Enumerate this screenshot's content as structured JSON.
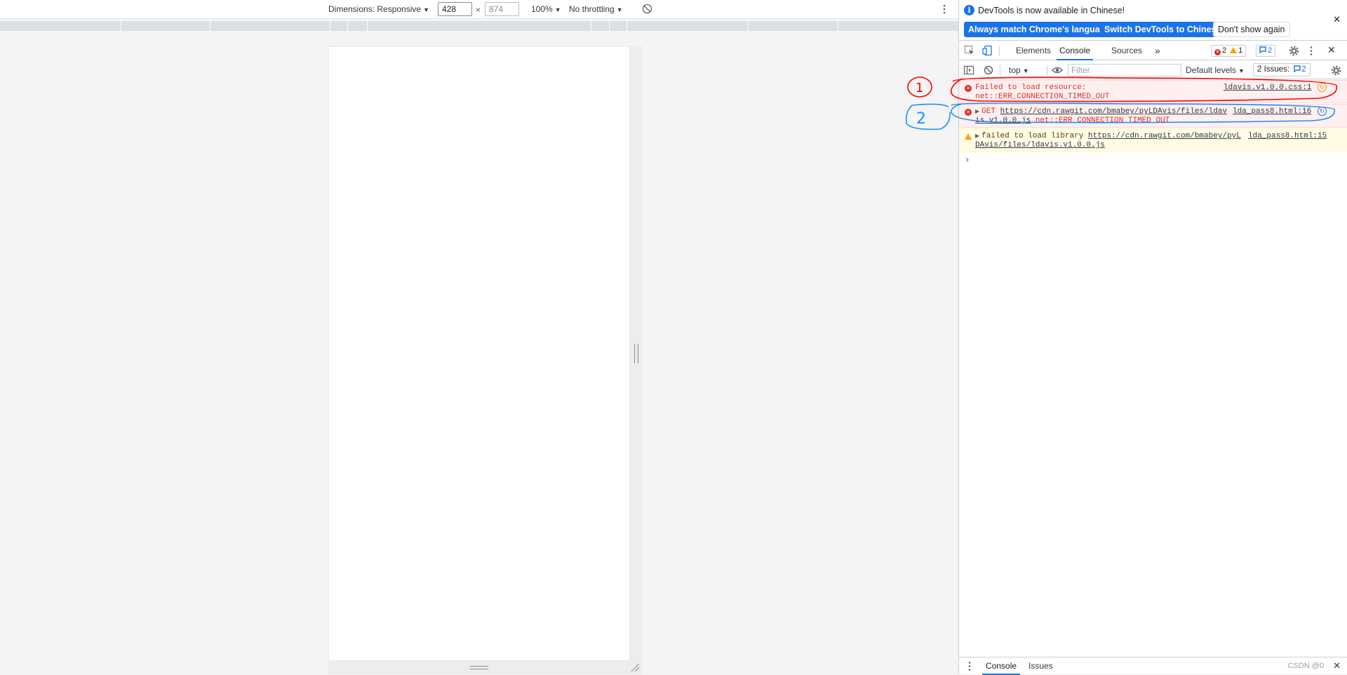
{
  "device_toolbar": {
    "dimensions_label": "Dimensions: Responsive",
    "width": "428",
    "times": "×",
    "height": "874",
    "zoom": "100%",
    "throttling": "No throttling"
  },
  "infobar": {
    "message": "DevTools is now available in Chinese!",
    "btn_match": "Always match Chrome's language",
    "btn_switch": "Switch DevTools to Chinese",
    "btn_dismiss": "Don't show again"
  },
  "tabs": {
    "elements": "Elements",
    "console": "Console",
    "sources": "Sources",
    "more": "»",
    "error_count": "2",
    "warning_count": "1",
    "message_count": "2"
  },
  "console_toolbar": {
    "context": "top",
    "filter_placeholder": "Filter",
    "levels": "Default levels",
    "issues_label": "2 Issues:",
    "issues_count": "2"
  },
  "logs": [
    {
      "level": "error",
      "line1": "Failed to load resource:",
      "line2": "net::ERR_CONNECTION_TIMED_OUT",
      "source": "ldavis.v1.0.0.css:1"
    },
    {
      "level": "error",
      "method": "GET",
      "url_part1": "https://cdn.rawgit.com/bmabey/pyLDAvis/files/ldav",
      "url_part2": "is.v1.0.0.js",
      "error": "net::ERR_CONNECTION_TIMED_OUT",
      "source": "lda_pass8.html:16"
    },
    {
      "level": "warning",
      "text": "failed to load library",
      "url_part1": "https://cdn.rawgit.com/bmabey/pyL",
      "url_part2": "DAvis/files/ldavis.v1.0.0.js",
      "source": "lda_pass8.html:15"
    }
  ],
  "drawer": {
    "console_tab": "Console",
    "issues_tab": "Issues",
    "watermark": "CSDN @0"
  },
  "annotations": {
    "label_1": "1",
    "label_2": "2",
    "color_1": "#ff0000",
    "color_2": "#1e90ff"
  }
}
